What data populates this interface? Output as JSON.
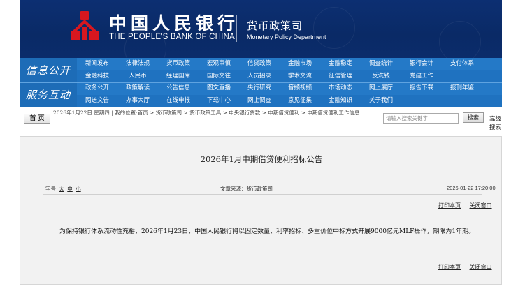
{
  "header": {
    "bank_name_cn": "中国人民银行",
    "bank_name_en": "THE PEOPLE'S BANK OF CHINA",
    "dept_name_cn": "货币政策司",
    "dept_name_en": "Monetary Policy Department",
    "colors": {
      "banner": "#0b2c6b",
      "nav": "#2479c7",
      "emblem": "#d7171f"
    }
  },
  "nav": {
    "section1": "信息公开",
    "section2": "服务互动",
    "rows": [
      [
        "新闻发布",
        "法律法规",
        "货币政策",
        "宏观审慎",
        "信贷政策",
        "金融市场",
        "金融稳定",
        "调查统计",
        "银行会计",
        "支付体系"
      ],
      [
        "金融科技",
        "人民币",
        "经理国库",
        "国际交往",
        "人员招录",
        "学术交流",
        "征信管理",
        "反洗钱",
        "党建工作"
      ],
      [
        "政务公开",
        "政策解读",
        "公告信息",
        "图文直播",
        "央行研究",
        "音频视频",
        "市场动态",
        "网上展厅",
        "报告下载",
        "报刊年鉴"
      ],
      [
        "网送文告",
        "办事大厅",
        "在线申报",
        "下载中心",
        "网上调查",
        "意见征集",
        "金融知识",
        "关于我们"
      ]
    ]
  },
  "breadcrumb": {
    "home_label": "首 页",
    "text": "2026年1月22日 星期四 | 我的位置:首页 > 货币政策司 > 货币政策工具 > 中央银行贷款 > 中期借贷便利 > 中期借贷便利工作信息",
    "search_placeholder": "请输入搜索关键字",
    "search_button": "搜索",
    "advanced_search": "高级搜索"
  },
  "article": {
    "title": "2026年1月中期借贷便利招标公告",
    "font_size_label": "字号",
    "font_sizes": [
      "大",
      "中",
      "小"
    ],
    "source": "文章来源：货币政策司",
    "date": "2026-01-22 17:20:00",
    "print_label": "打印本页",
    "close_label": "关闭窗口",
    "body": "为保持银行体系流动性充裕，2026年1月23日，中国人民银行将以固定数量、利率招标、多重价位中标方式开展9000亿元MLF操作，期限为1年期。"
  }
}
